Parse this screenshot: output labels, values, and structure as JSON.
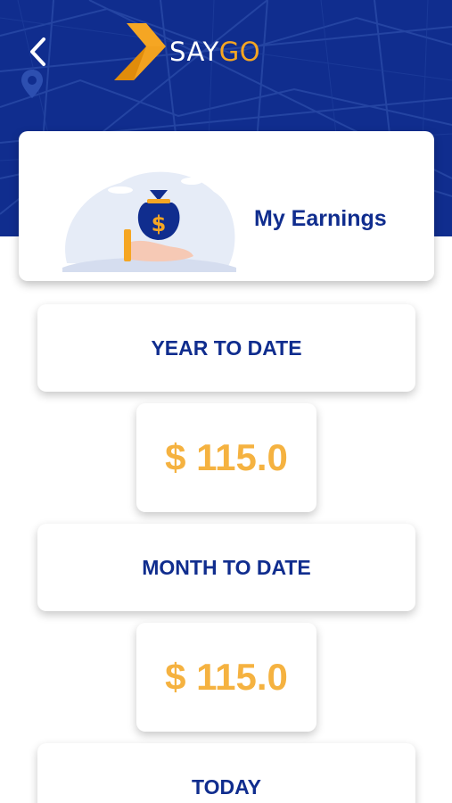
{
  "brand": {
    "name_part1": "SAY",
    "name_part2": "GO"
  },
  "colors": {
    "header_bg": "#102d8e",
    "accent": "#f5a623",
    "amount": "#f5b240",
    "title": "#102d8e"
  },
  "icons": {
    "back": "chevron-left-icon",
    "logo": "arrow-logo-icon",
    "map_pin": "location-pin-icon",
    "earnings": "money-bag-hand-icon"
  },
  "earnings_card": {
    "title": "My Earnings"
  },
  "sections": [
    {
      "label": "YEAR TO DATE",
      "amount": "$ 115.0"
    },
    {
      "label": "MONTH TO DATE",
      "amount": "$ 115.0"
    },
    {
      "label": "TODAY"
    }
  ]
}
